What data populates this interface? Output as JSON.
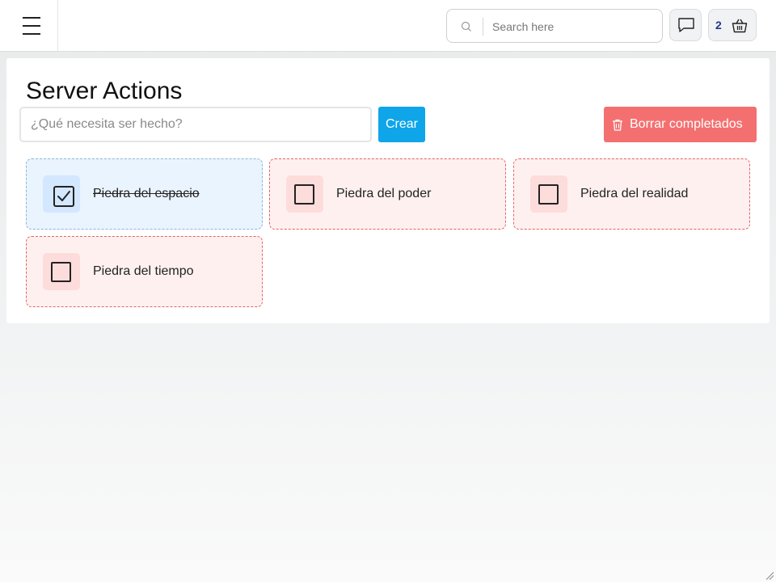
{
  "header": {
    "search": {
      "placeholder": "Search here",
      "value": ""
    },
    "cart": {
      "count": "2"
    },
    "icons": {
      "menu": "hamburger-icon",
      "search": "search-icon",
      "chat": "chat-bubble-icon",
      "cart": "shopping-basket-icon"
    }
  },
  "main": {
    "title": "Server Actions",
    "new_task": {
      "placeholder": "¿Qué necesita ser hecho?",
      "value": ""
    },
    "create_label": "Crear",
    "clear_label": "Borrar completados",
    "tasks": [
      {
        "label": "Piedra del espacio",
        "completed": true
      },
      {
        "label": "Piedra del poder",
        "completed": false
      },
      {
        "label": "Piedra del realidad",
        "completed": false
      },
      {
        "label": "Piedra del tiempo",
        "completed": false
      }
    ]
  },
  "colors": {
    "create_button": "#0ea5e9",
    "clear_button": "#f47070",
    "done_card": "#eaf4ff",
    "open_card": "#fff0f0",
    "cart_count": "#1e3a8a"
  }
}
